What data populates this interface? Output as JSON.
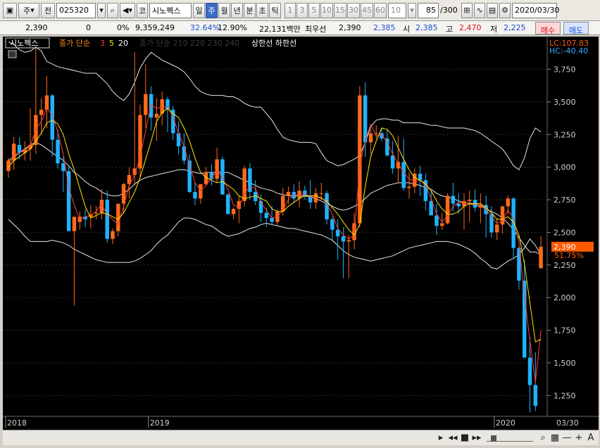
{
  "toolbar": {
    "market_label": "주",
    "type_label": "전",
    "code": "025320",
    "name_prefix": "코",
    "name": "시노펙스",
    "period_buttons": [
      "일",
      "주",
      "월",
      "년",
      "분",
      "초",
      "틱"
    ],
    "selected_period": "주",
    "interval_buttons": [
      "1",
      "3",
      "5",
      "10",
      "15",
      "30",
      "45",
      "60"
    ],
    "interval_value": "10",
    "count_value": "85",
    "count_total": "/300",
    "date_value": "2020/03/30"
  },
  "quote": {
    "price": "2,390",
    "change": "0",
    "change_pct": "0%",
    "volume": "9,359,249",
    "turnover_pct": "32.64%",
    "other_pct": "12.90%",
    "amount": "22,131백만",
    "prior_label": "최우선",
    "prior_value": "2,390",
    "bid_value": "2,385",
    "open_label": "시",
    "open_value": "2,385",
    "high_label": "고",
    "high_value": "2,470",
    "low_label": "저",
    "low_value": "2,225",
    "buy_label": "매수",
    "sell_label": "매도"
  },
  "legend": {
    "name": "시노펙스",
    "ma_label": "종가 단순",
    "ma_periods": [
      "3",
      "5",
      "20"
    ],
    "ma_dim": "종가 단순 210  220 230 240",
    "envelope": "상한선  하한선",
    "lc": "LC:107.83",
    "hc": "HC:-40.40"
  },
  "colors": {
    "up": "#ff6a1a",
    "down": "#1fb3ff",
    "bg": "#000000",
    "grid": "#2a2a2a",
    "band": "#e8e8e8",
    "ma3": "#ff3b3b",
    "ma5": "#ffe800",
    "price_tag": "#ff5a00"
  },
  "chart_data": {
    "type": "candlestick",
    "y_ticks": [
      "3,750",
      "3,500",
      "3,250",
      "3,000",
      "2,750",
      "2,500",
      "2,250",
      "2,000",
      "1,750",
      "1,500",
      "1,250"
    ],
    "y_tick_values": [
      3750,
      3500,
      3250,
      3000,
      2750,
      2500,
      2250,
      2000,
      1750,
      1500,
      1250
    ],
    "ylim": [
      1090,
      3990
    ],
    "x_labels": [
      "2018",
      "2019",
      "2020",
      "03/30"
    ],
    "last_price_label": "2,390",
    "last_pct_label": "51.75%",
    "last_price": 2390,
    "candles": [
      [
        2970,
        3070,
        2920,
        3050
      ],
      [
        3050,
        3230,
        2980,
        3180
      ],
      [
        3170,
        3230,
        3060,
        3110
      ],
      [
        3110,
        3200,
        3050,
        3140
      ],
      [
        3140,
        3450,
        3050,
        3170
      ],
      [
        3170,
        3930,
        3100,
        3400
      ],
      [
        3400,
        3530,
        3250,
        3440
      ],
      [
        3440,
        3700,
        3300,
        3550
      ],
      [
        3550,
        3560,
        3080,
        3210
      ],
      [
        3210,
        3290,
        2990,
        3030
      ],
      [
        3030,
        3080,
        2810,
        2970
      ],
      [
        2970,
        3010,
        2580,
        2510
      ],
      [
        2510,
        2560,
        1940,
        2620
      ],
      [
        2580,
        2660,
        2520,
        2620
      ],
      [
        2620,
        2680,
        2540,
        2600
      ],
      [
        2620,
        2710,
        2530,
        2640
      ],
      [
        2650,
        2700,
        2600,
        2650
      ],
      [
        2650,
        2830,
        2600,
        2750
      ],
      [
        2750,
        2820,
        2420,
        2450
      ],
      [
        2450,
        2530,
        2410,
        2510
      ],
      [
        2510,
        2590,
        2470,
        2720
      ],
      [
        2720,
        2880,
        2650,
        2870
      ],
      [
        2870,
        3000,
        2760,
        2940
      ],
      [
        2940,
        3880,
        2860,
        2990
      ],
      [
        2990,
        3480,
        2920,
        3400
      ],
      [
        3400,
        3790,
        3300,
        3560
      ],
      [
        3560,
        3620,
        3280,
        3380
      ],
      [
        3380,
        3530,
        3200,
        3410
      ],
      [
        3410,
        3580,
        3320,
        3520
      ],
      [
        3520,
        3540,
        3270,
        3440
      ],
      [
        3440,
        3470,
        3210,
        3260
      ],
      [
        3260,
        3350,
        3100,
        3160
      ],
      [
        3160,
        3260,
        3020,
        3050
      ],
      [
        3050,
        3100,
        2800,
        2810
      ],
      [
        2810,
        2880,
        2710,
        2760
      ],
      [
        2760,
        2870,
        2720,
        2870
      ],
      [
        2870,
        3000,
        2860,
        2960
      ],
      [
        2960,
        3020,
        2860,
        2910
      ],
      [
        2910,
        3150,
        2880,
        3060
      ],
      [
        3060,
        3080,
        2790,
        2790
      ],
      [
        2790,
        2800,
        2640,
        2640
      ],
      [
        2640,
        2690,
        2600,
        2680
      ],
      [
        2680,
        2780,
        2570,
        2740
      ],
      [
        2740,
        3010,
        2700,
        2990
      ],
      [
        2990,
        3030,
        2750,
        2810
      ],
      [
        2810,
        2900,
        2710,
        2740
      ],
      [
        2740,
        2790,
        2580,
        2650
      ],
      [
        2650,
        2690,
        2540,
        2610
      ],
      [
        2610,
        2700,
        2560,
        2580
      ],
      [
        2580,
        2680,
        2550,
        2660
      ],
      [
        2660,
        2840,
        2630,
        2780
      ],
      [
        2780,
        2850,
        2720,
        2810
      ],
      [
        2810,
        2870,
        2730,
        2760
      ],
      [
        2760,
        2890,
        2690,
        2820
      ],
      [
        2820,
        2860,
        2750,
        2780
      ],
      [
        2780,
        2900,
        2680,
        2730
      ],
      [
        2730,
        2840,
        2680,
        2800
      ],
      [
        2800,
        2880,
        2750,
        2800
      ],
      [
        2800,
        2820,
        2560,
        2600
      ],
      [
        2600,
        2620,
        2430,
        2520
      ],
      [
        2520,
        2600,
        2290,
        2470
      ],
      [
        2470,
        2540,
        2150,
        2430
      ],
      [
        2430,
        2480,
        2150,
        2440
      ],
      [
        2440,
        2650,
        2370,
        2570
      ],
      [
        2570,
        3620,
        2540,
        3550
      ],
      [
        3550,
        3650,
        3080,
        3190
      ],
      [
        3190,
        3290,
        3100,
        3260
      ],
      [
        3260,
        3320,
        3220,
        3260
      ],
      [
        3260,
        3300,
        3200,
        3220
      ],
      [
        3220,
        3290,
        3080,
        3090
      ],
      [
        3090,
        3200,
        2950,
        2990
      ],
      [
        2990,
        3240,
        2880,
        3040
      ],
      [
        3040,
        3220,
        2820,
        2840
      ],
      [
        2840,
        2960,
        2760,
        2850
      ],
      [
        2850,
        2990,
        2800,
        2950
      ],
      [
        2950,
        3010,
        2780,
        2900
      ],
      [
        2900,
        2950,
        2670,
        2740
      ],
      [
        2740,
        2820,
        2640,
        2630
      ],
      [
        2630,
        2720,
        2480,
        2550
      ],
      [
        2550,
        2650,
        2520,
        2570
      ],
      [
        2570,
        2800,
        2560,
        2780
      ],
      [
        2780,
        2880,
        2660,
        2720
      ],
      [
        2720,
        2800,
        2640,
        2700
      ],
      [
        2700,
        2800,
        2520,
        2740
      ],
      [
        2740,
        2820,
        2580,
        2750
      ],
      [
        2750,
        2830,
        2660,
        2690
      ],
      [
        2690,
        2800,
        2570,
        2710
      ],
      [
        2710,
        2780,
        2460,
        2640
      ],
      [
        2640,
        2700,
        2460,
        2500
      ],
      [
        2500,
        2610,
        2440,
        2560
      ],
      [
        2560,
        2690,
        2490,
        2700
      ],
      [
        2700,
        2780,
        2640,
        2760
      ],
      [
        2760,
        2770,
        2300,
        2380
      ],
      [
        2380,
        2390,
        2060,
        2130
      ],
      [
        2130,
        2290,
        1580,
        1540
      ],
      [
        1540,
        1700,
        1120,
        1330
      ],
      [
        1330,
        1580,
        1130,
        1170
      ],
      [
        2225,
        2470,
        2225,
        2390
      ]
    ],
    "ma3": [
      3000,
      3090,
      3110,
      3130,
      3160,
      3290,
      3350,
      3450,
      3400,
      3270,
      3100,
      2840,
      2710,
      2600,
      2620,
      2630,
      2660,
      2720,
      2630,
      2600,
      2560,
      2700,
      2860,
      2940,
      3080,
      3280,
      3480,
      3450,
      3460,
      3460,
      3380,
      3260,
      3160,
      3010,
      2880,
      2820,
      2860,
      2920,
      2970,
      2920,
      2830,
      2710,
      2690,
      2800,
      2850,
      2840,
      2730,
      2670,
      2610,
      2620,
      2670,
      2750,
      2790,
      2790,
      2800,
      2770,
      2770,
      2770,
      2720,
      2640,
      2530,
      2480,
      2450,
      2480,
      3010,
      3200,
      3330,
      3240,
      3250,
      3190,
      3100,
      3030,
      2960,
      2910,
      2890,
      2900,
      2860,
      2760,
      2640,
      2580,
      2630,
      2700,
      2730,
      2720,
      2730,
      2710,
      2720,
      2680,
      2620,
      2570,
      2590,
      2670,
      2610,
      2420,
      2020,
      1670,
      1350,
      1750
    ],
    "ma5": [
      3000,
      3050,
      3080,
      3110,
      3140,
      3200,
      3260,
      3340,
      3360,
      3330,
      3250,
      3100,
      2980,
      2840,
      2700,
      2610,
      2630,
      2650,
      2640,
      2620,
      2600,
      2650,
      2730,
      2810,
      2920,
      3060,
      3200,
      3350,
      3420,
      3450,
      3410,
      3380,
      3300,
      3200,
      3070,
      2960,
      2920,
      2900,
      2880,
      2890,
      2860,
      2830,
      2780,
      2760,
      2770,
      2780,
      2760,
      2740,
      2680,
      2660,
      2660,
      2700,
      2730,
      2760,
      2780,
      2780,
      2780,
      2760,
      2740,
      2690,
      2640,
      2580,
      2520,
      2480,
      2560,
      2850,
      3080,
      3200,
      3300,
      3290,
      3240,
      3150,
      3060,
      2980,
      2920,
      2900,
      2870,
      2820,
      2740,
      2680,
      2640,
      2640,
      2660,
      2700,
      2720,
      2720,
      2720,
      2690,
      2650,
      2600,
      2600,
      2620,
      2580,
      2480,
      2260,
      1960,
      1660,
      1680
    ],
    "band_upper": [
      3960,
      3940,
      3900,
      3880,
      3890,
      3920,
      3890,
      3810,
      3790,
      3770,
      3760,
      3750,
      3740,
      3730,
      3720,
      3720,
      3720,
      3680,
      3640,
      3580,
      3540,
      3510,
      3560,
      3650,
      3760,
      3830,
      3880,
      3850,
      3820,
      3800,
      3780,
      3760,
      3730,
      3680,
      3620,
      3580,
      3560,
      3550,
      3550,
      3550,
      3540,
      3540,
      3520,
      3490,
      3470,
      3460,
      3460,
      3410,
      3360,
      3290,
      3230,
      3210,
      3200,
      3190,
      3190,
      3190,
      3180,
      3110,
      3050,
      3030,
      3010,
      3020,
      3040,
      3060,
      3090,
      3190,
      3310,
      3360,
      3370,
      3370,
      3360,
      3360,
      3340,
      3340,
      3340,
      3340,
      3330,
      3320,
      3320,
      3310,
      3300,
      3300,
      3300,
      3300,
      3290,
      3280,
      3260,
      3230,
      3200,
      3170,
      3140,
      3080,
      3010,
      2980,
      3070,
      3220,
      3300,
      3270
    ],
    "band_mid": [
      3050,
      3080,
      3110,
      3140,
      3170,
      3190,
      3170,
      3140,
      3110,
      3080,
      3050,
      3010,
      2960,
      2930,
      2890,
      2860,
      2840,
      2810,
      2790,
      2780,
      2780,
      2800,
      2830,
      2870,
      2900,
      2920,
      2930,
      2940,
      2950,
      2960,
      2970,
      2980,
      2980,
      2970,
      2960,
      2950,
      2960,
      2960,
      2960,
      2960,
      2960,
      2940,
      2920,
      2900,
      2880,
      2860,
      2840,
      2830,
      2820,
      2800,
      2790,
      2780,
      2780,
      2780,
      2780,
      2770,
      2760,
      2740,
      2720,
      2700,
      2680,
      2670,
      2680,
      2700,
      2720,
      2760,
      2800,
      2820,
      2840,
      2860,
      2870,
      2880,
      2880,
      2880,
      2870,
      2860,
      2840,
      2830,
      2800,
      2780,
      2770,
      2760,
      2740,
      2730,
      2720,
      2710,
      2700,
      2680,
      2660,
      2640,
      2610,
      2570,
      2520,
      2460,
      2400,
      2350,
      2350,
      2330
    ],
    "band_lower": [
      2600,
      2560,
      2520,
      2470,
      2430,
      2430,
      2430,
      2430,
      2440,
      2430,
      2420,
      2400,
      2370,
      2350,
      2330,
      2310,
      2290,
      2280,
      2270,
      2270,
      2270,
      2270,
      2270,
      2280,
      2300,
      2330,
      2360,
      2410,
      2450,
      2480,
      2530,
      2580,
      2610,
      2610,
      2600,
      2580,
      2560,
      2550,
      2520,
      2490,
      2470,
      2480,
      2490,
      2510,
      2530,
      2540,
      2560,
      2570,
      2560,
      2550,
      2540,
      2530,
      2530,
      2520,
      2510,
      2500,
      2490,
      2480,
      2460,
      2440,
      2400,
      2360,
      2330,
      2310,
      2300,
      2290,
      2280,
      2290,
      2300,
      2310,
      2320,
      2340,
      2360,
      2380,
      2390,
      2400,
      2410,
      2420,
      2430,
      2430,
      2430,
      2420,
      2410,
      2390,
      2370,
      2340,
      2300,
      2270,
      2230,
      2220,
      2250,
      2280,
      2300,
      2330,
      2380,
      2450,
      2400,
      2330
    ]
  },
  "bottom": {
    "icons": [
      "arrow-left-icon",
      "prev-icon",
      "stop-icon",
      "next-icon",
      "slider-icon",
      "zoom-icon",
      "chart-icon",
      "minus-icon",
      "plus-icon",
      "font-icon"
    ]
  }
}
